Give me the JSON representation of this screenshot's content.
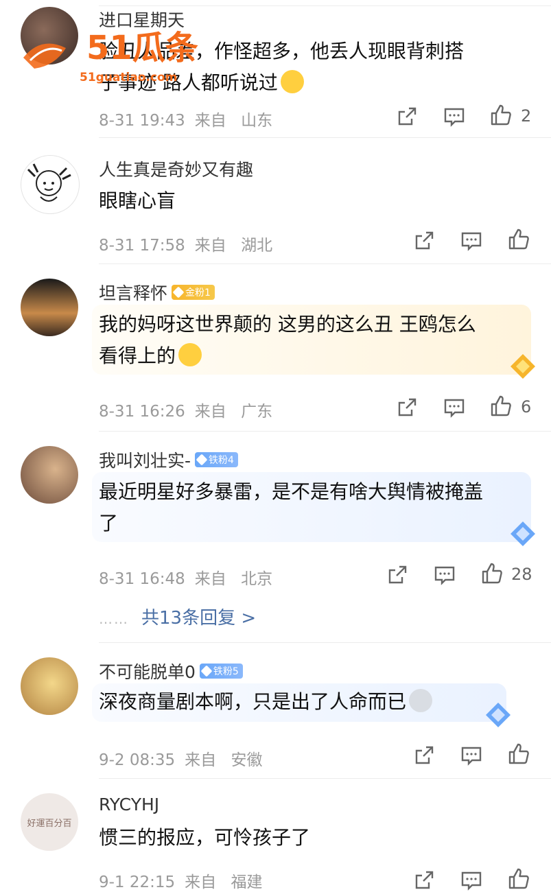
{
  "watermark": {
    "brand": "51瓜条",
    "url": "51guatiao.com"
  },
  "reply_link": {
    "dots": "……",
    "label": "共13条回复 >"
  },
  "comments": [
    {
      "username": "进口星期天",
      "text_lines": [
        "脸丑人品差，作怪超多，他丢人现眼背刺搭",
        "子事迹 路人都听说过"
      ],
      "date": "8-31 19:43",
      "source_prefix": "来自",
      "location": "山东",
      "likes": "2",
      "emoji": "tears-of-joy"
    },
    {
      "username": "人生真是奇妙又有趣",
      "text_lines": [
        "眼瞎心盲"
      ],
      "date": "8-31 17:58",
      "source_prefix": "来自",
      "location": "湖北",
      "likes": ""
    },
    {
      "username": "坦言释怀",
      "badge": "金粉1",
      "badge_type": "gold",
      "text_lines": [
        "我的妈呀这世界颠的 这男的这么丑 王鸥怎么",
        "看得上的"
      ],
      "date": "8-31 16:26",
      "source_prefix": "来自",
      "location": "广东",
      "likes": "6",
      "emoji": "crying"
    },
    {
      "username": "我叫刘壮实-",
      "badge": "铁粉4",
      "badge_type": "iron",
      "text_lines": [
        "最近明星好多暴雷，是不是有啥大舆情被掩盖",
        "了"
      ],
      "date": "8-31 16:48",
      "source_prefix": "来自",
      "location": "北京",
      "likes": "28"
    },
    {
      "username": "不可能脱单0",
      "badge": "铁粉5",
      "badge_type": "iron",
      "text_lines": [
        "深夜商量剧本啊，只是出了人命而已"
      ],
      "date": "9-2 08:35",
      "source_prefix": "来自",
      "location": "安徽",
      "likes": "",
      "emoji": "husky"
    },
    {
      "username": "RYCYHJ",
      "avatar_text": "好運百分百",
      "text_lines": [
        "惯三的报应，可怜孩子了"
      ],
      "date": "9-1 22:15",
      "source_prefix": "来自",
      "location": "福建",
      "likes": ""
    }
  ],
  "colors": {
    "meta": "#9a9a9a",
    "link": "#4a6fa5",
    "gold_badge": "#f7b52c",
    "iron_badge": "#6aa7f8"
  },
  "icons": [
    "share-icon",
    "comment-icon",
    "like-icon"
  ]
}
